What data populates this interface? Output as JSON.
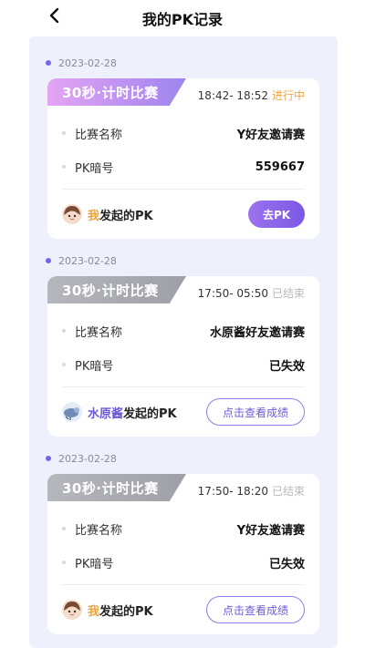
{
  "header": {
    "title": "我的PK记录"
  },
  "records": [
    {
      "date": "2023-02-28",
      "tag": "30秒·计时比赛",
      "time_range": "18:42- 18:52",
      "status": "进行中",
      "rows": [
        {
          "label": "比赛名称",
          "value": "Y好友邀请赛"
        },
        {
          "label": "PK暗号",
          "value": "559667"
        }
      ],
      "initiator_name": "我",
      "initiator_suffix": "发起的PK",
      "action_label": "去PK"
    },
    {
      "date": "2023-02-28",
      "tag": "30秒·计时比赛",
      "time_range": "17:50- 05:50",
      "status": "已结束",
      "rows": [
        {
          "label": "比赛名称",
          "value": "水原酱好友邀请赛"
        },
        {
          "label": "PK暗号",
          "value": "已失效"
        }
      ],
      "initiator_name": "水原酱",
      "initiator_suffix": "发起的PK",
      "action_label": "点击查看成绩"
    },
    {
      "date": "2023-02-28",
      "tag": "30秒·计时比赛",
      "time_range": "17:50- 18:20",
      "status": "已结束",
      "rows": [
        {
          "label": "比赛名称",
          "value": "Y好友邀请赛"
        },
        {
          "label": "PK暗号",
          "value": "已失效"
        }
      ],
      "initiator_name": "我",
      "initiator_suffix": "发起的PK",
      "action_label": "点击查看成绩"
    }
  ],
  "colors": {
    "accent": "#7b58e4",
    "ongoing": "#f0a540",
    "finished": "#b8b9c0",
    "background": "#eef0fb"
  },
  "icons": {
    "back": "chevron-left-icon",
    "avatar_me": "avatar-girl-icon",
    "avatar_other": "avatar-blue-icon"
  }
}
